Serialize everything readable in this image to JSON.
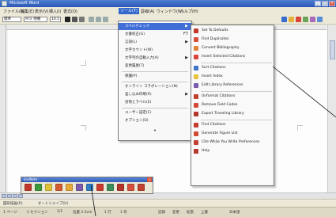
{
  "window": {
    "title": "Microsoft Word",
    "buttons": [
      "_",
      "□",
      "×"
    ]
  },
  "menubar": {
    "items": [
      "ファイル(F)",
      "編集(E)",
      "表示(V)",
      "挿入(I)",
      "書式(O)",
      "ツール(T)",
      "罫線(A)",
      "ウィンドウ(W)",
      "ヘルプ(H)"
    ],
    "active": "ツール(T)"
  },
  "toolbar": {
    "style_value": "標準",
    "font_value": "ＭＳ 明朝",
    "size_value": "10.5"
  },
  "tools_menu": {
    "items": [
      {
        "label": "スペルチェック",
        "has_submenu": true,
        "highlight": true
      },
      {
        "label": "文書校正(G)",
        "shortcut": "F7"
      },
      {
        "label": "言語(L)",
        "has_submenu": true
      },
      {
        "label": "文字カウント(W)"
      },
      {
        "label": "文字列の自動入力(A)",
        "has_submenu": true
      },
      {
        "label": "変更履歴(T)"
      },
      {
        "label": "保護(P)"
      },
      {
        "label": "オンライン コラボレーション(N)"
      },
      {
        "label": "差し込み印刷(R)",
        "has_submenu": true
      },
      {
        "label": "封筒とラベル(E)"
      },
      {
        "label": "ユーザー設定(C)"
      },
      {
        "label": "オプション(O)"
      },
      {
        "label": "▾"
      }
    ]
  },
  "addin_submenu": {
    "items": [
      {
        "label": "Set To Defaults",
        "icon_color": "#c0392b"
      },
      {
        "label": "Find Duplicates",
        "icon_color": "#d64f3a"
      },
      {
        "label": "Convert Bibliography",
        "icon_color": "#e2833a"
      },
      {
        "label": "Insert Selected Citations",
        "icon_color": "#d9453a"
      },
      {
        "label": "Sort Citations",
        "icon_color": "#3f74c9"
      },
      {
        "label": "Insert Index",
        "icon_color": "#e9c33a"
      },
      {
        "label": "Edit Library References",
        "icon_color": "#7a5bb0"
      },
      {
        "label": "Unformat Citations",
        "icon_color": "#c2402f"
      },
      {
        "label": "Remove Field Codes",
        "icon_color": "#d3483a"
      },
      {
        "label": "Export Traveling Library",
        "icon_color": "#b3342a"
      },
      {
        "label": "Find Citations",
        "icon_color": "#c93a2e"
      },
      {
        "label": "Generate Figure List",
        "icon_color": "#cf4a33"
      },
      {
        "label": "Cite While You Write Preferences",
        "icon_color": "#c13f33"
      },
      {
        "label": "Help",
        "icon_color": "#b7382c"
      }
    ]
  },
  "floating_toolbar": {
    "title": "EndNote",
    "close": "×",
    "button_colors": [
      "#c0392b",
      "#3c9a3c",
      "#e0c23a",
      "#d45b2f",
      "#e8a83a",
      "#7a5bb0",
      "#2f7fc9",
      "#c93a2e",
      "#3b8f5a",
      "#b3342a",
      "#d64f3a",
      "#c2402f"
    ]
  },
  "drawbar": {
    "items": [
      "図形描画(R)",
      "オートシェイプ(U)"
    ]
  },
  "statusbar": {
    "items": [
      "1 ページ",
      "1 セクション",
      "1/1",
      "位置 2.5cm",
      "1 行",
      "1 桁",
      "記録",
      "変更",
      "拡張",
      "上書",
      "日本語"
    ]
  },
  "colors": {
    "titlebar": "#2a57b5",
    "menu_highlight": "#3f6ed6",
    "chrome": "#ece9d8"
  }
}
